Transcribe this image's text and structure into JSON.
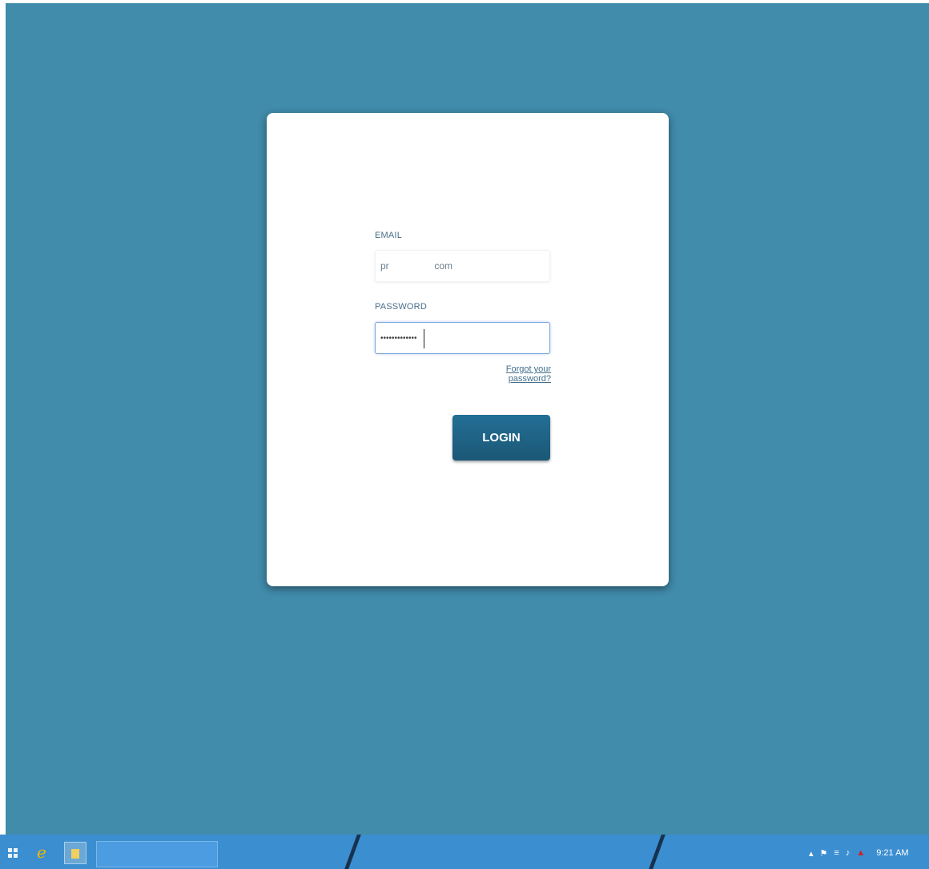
{
  "login": {
    "email_label": "EMAIL",
    "email_value": "pr                 com",
    "password_label": "PASSWORD",
    "password_value": "•••••••••••••",
    "forgot_link": "Forgot your password?",
    "login_button": "LOGIN"
  },
  "taskbar": {
    "clock": "9:21 AM",
    "icons": [
      "start-icon",
      "internet-explorer-icon",
      "file-explorer-icon"
    ],
    "tray_icons": [
      "show-hidden-icons-arrow",
      "action-center-flag-icon",
      "network-icon",
      "volume-icon",
      "acrobat-icon"
    ]
  },
  "colors": {
    "desktop_background": "#418bab",
    "login_button": "#236f95",
    "taskbar": "#3b8ed0"
  }
}
